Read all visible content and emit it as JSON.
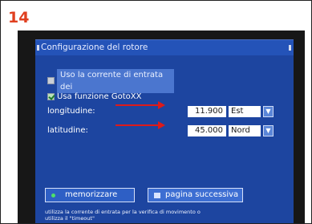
{
  "step_number": "14",
  "dialog": {
    "title": "Configurazione del rotore",
    "options": [
      {
        "label": "Uso la corrente di entrata dei",
        "checked": false
      },
      {
        "label": "Usa funzione GotoXX",
        "checked": true
      }
    ],
    "longitude": {
      "label": "longitudine:",
      "value": "11.900",
      "direction": "Est"
    },
    "latitude": {
      "label": "latitudine:",
      "value": "45.000",
      "direction": "Nord"
    },
    "buttons": {
      "save": "memorizzare",
      "next": "pagina successiva"
    },
    "help_text": "utilizza la corrente di entrata per la verifica di movimento o\nutilizza il \"timeout\""
  },
  "colors": {
    "arrow": "#dd1a1a",
    "dialog_background": "#1d45a0",
    "step_number": "#e04020"
  }
}
